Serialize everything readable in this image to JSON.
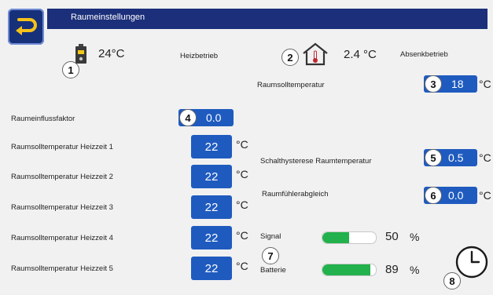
{
  "header": {
    "title": "Raumeinstellungen"
  },
  "status": {
    "room_temp": "24°C",
    "heating_mode": "Heizbetrieb",
    "outdoor_temp": "2.4 °C",
    "setback_mode": "Absenkbetrieb"
  },
  "badges": [
    "1",
    "2",
    "3",
    "4",
    "5",
    "6",
    "7",
    "8"
  ],
  "raumsolltemperatur": {
    "label": "Raumsolltemperatur",
    "value": "18",
    "unit": "°C"
  },
  "raumeinflussfaktor": {
    "label": "Raumeinflussfaktor",
    "value": "0.0"
  },
  "heizzeiten": [
    {
      "label": "Raumsolltemperatur Heizzeit 1",
      "value": "22",
      "unit": "°C"
    },
    {
      "label": "Raumsolltemperatur Heizzeit 2",
      "value": "22",
      "unit": "°C"
    },
    {
      "label": "Raumsolltemperatur Heizzeit 3",
      "value": "22",
      "unit": "°C"
    },
    {
      "label": "Raumsolltemperatur Heizzeit 4",
      "value": "22",
      "unit": "°C"
    },
    {
      "label": "Raumsolltemperatur Heizzeit 5",
      "value": "22",
      "unit": "°C"
    }
  ],
  "schalthysterese": {
    "label": "Schalthysterese Raumtemperatur",
    "value": "0.5",
    "unit": "°C"
  },
  "raumfuehlerabgleich": {
    "label": "Raumfühlerabgleich",
    "value": "0.0",
    "unit": "°C"
  },
  "signal": {
    "label": "Signal",
    "value": "50",
    "unit": "%",
    "level": 0.5
  },
  "batterie": {
    "label": "Batterie",
    "value": "89",
    "unit": "%",
    "level": 0.89
  },
  "icons": {
    "back": "back-arrow-icon",
    "device": "room-sensor-icon",
    "house": "house-thermometer-icon",
    "clock": "clock-icon"
  },
  "colors": {
    "header": "#1c2f7a",
    "value_box": "#1f5bbf",
    "bar_fill": "#22b14c"
  }
}
